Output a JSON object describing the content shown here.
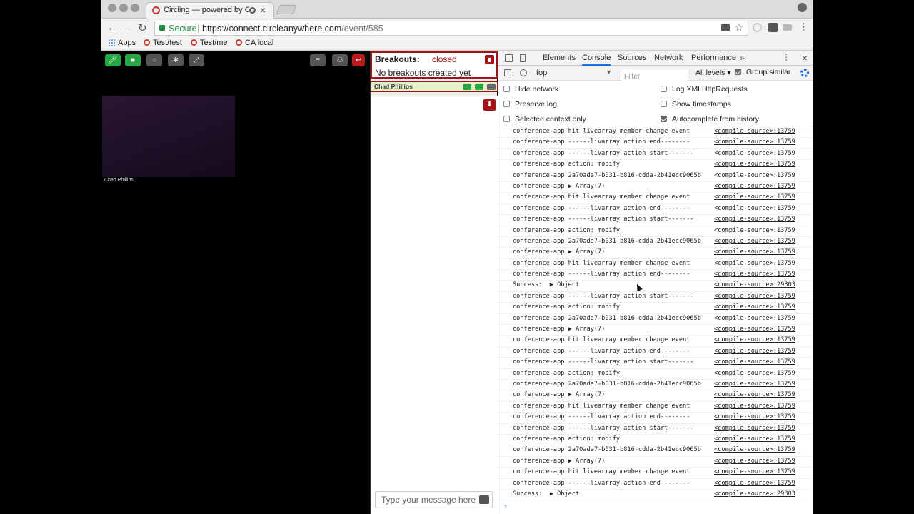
{
  "browser": {
    "tab_title": "Circling — powered by Circling",
    "url_secure_label": "Secure",
    "url_host": "https://connect.circleanywhere.com",
    "url_path": "/event/585",
    "bookmarks": [
      {
        "label": "Apps"
      },
      {
        "label": "Test/test"
      },
      {
        "label": "Test/me"
      },
      {
        "label": "CA local"
      }
    ]
  },
  "video": {
    "participant_name": "Chad Phillips"
  },
  "breakouts": {
    "title": "Breakouts:",
    "status": "closed",
    "empty_message": "No breakouts created yet",
    "room_participant": "Chad Phillips",
    "chat_placeholder": "Type your message here"
  },
  "devtools": {
    "tabs": [
      "Elements",
      "Console",
      "Sources",
      "Network",
      "Performance"
    ],
    "more": "»",
    "context": "top",
    "filter_placeholder": "Filter",
    "levels": "All levels ▾",
    "group_similar": "Group similar",
    "options": {
      "hide_network": "Hide network",
      "preserve_log": "Preserve log",
      "selected_context": "Selected context only",
      "log_xhr": "Log XMLHttpRequests",
      "show_timestamps": "Show timestamps",
      "autocomplete": "Autocomplete from history"
    },
    "logs": [
      {
        "msg": "conference-app hit livearray member change event",
        "src": "<compile-source>:13759"
      },
      {
        "msg": "conference-app ------livarray action end--------",
        "src": "<compile-source>:13759"
      },
      {
        "msg": "conference-app ------livarray action start-------",
        "src": "<compile-source>:13759"
      },
      {
        "msg": "conference-app action: modify",
        "src": "<compile-source>:13759"
      },
      {
        "msg": "conference-app 2a70ade7-b031-b816-cdda-2b41ecc9065b",
        "src": "<compile-source>:13759"
      },
      {
        "msg": "conference-app ▶ Array(7)",
        "src": "<compile-source>:13759"
      },
      {
        "msg": "conference-app hit livearray member change event",
        "src": "<compile-source>:13759"
      },
      {
        "msg": "conference-app ------livarray action end--------",
        "src": "<compile-source>:13759"
      },
      {
        "msg": "conference-app ------livarray action start-------",
        "src": "<compile-source>:13759"
      },
      {
        "msg": "conference-app action: modify",
        "src": "<compile-source>:13759"
      },
      {
        "msg": "conference-app 2a70ade7-b031-b816-cdda-2b41ecc9065b",
        "src": "<compile-source>:13759"
      },
      {
        "msg": "conference-app ▶ Array(7)",
        "src": "<compile-source>:13759"
      },
      {
        "msg": "conference-app hit livearray member change event",
        "src": "<compile-source>:13759"
      },
      {
        "msg": "conference-app ------livarray action end--------",
        "src": "<compile-source>:13759"
      },
      {
        "msg": "Success:  ▶ Object",
        "src": "<compile-source>:29803"
      },
      {
        "msg": "conference-app ------livarray action start-------",
        "src": "<compile-source>:13759"
      },
      {
        "msg": "conference-app action: modify",
        "src": "<compile-source>:13759"
      },
      {
        "msg": "conference-app 2a70ade7-b031-b816-cdda-2b41ecc9065b",
        "src": "<compile-source>:13759"
      },
      {
        "msg": "conference-app ▶ Array(7)",
        "src": "<compile-source>:13759"
      },
      {
        "msg": "conference-app hit livearray member change event",
        "src": "<compile-source>:13759"
      },
      {
        "msg": "conference-app ------livarray action end--------",
        "src": "<compile-source>:13759"
      },
      {
        "msg": "conference-app ------livarray action start-------",
        "src": "<compile-source>:13759"
      },
      {
        "msg": "conference-app action: modify",
        "src": "<compile-source>:13759"
      },
      {
        "msg": "conference-app 2a70ade7-b031-b816-cdda-2b41ecc9065b",
        "src": "<compile-source>:13759"
      },
      {
        "msg": "conference-app ▶ Array(7)",
        "src": "<compile-source>:13759"
      },
      {
        "msg": "conference-app hit livearray member change event",
        "src": "<compile-source>:13759"
      },
      {
        "msg": "conference-app ------livarray action end--------",
        "src": "<compile-source>:13759"
      },
      {
        "msg": "conference-app ------livarray action start-------",
        "src": "<compile-source>:13759"
      },
      {
        "msg": "conference-app action: modify",
        "src": "<compile-source>:13759"
      },
      {
        "msg": "conference-app 2a70ade7-b031-b816-cdda-2b41ecc9065b",
        "src": "<compile-source>:13759"
      },
      {
        "msg": "conference-app ▶ Array(7)",
        "src": "<compile-source>:13759"
      },
      {
        "msg": "conference-app hit livearray member change event",
        "src": "<compile-source>:13759"
      },
      {
        "msg": "conference-app ------livarray action end--------",
        "src": "<compile-source>:13759"
      },
      {
        "msg": "Success:  ▶ Object",
        "src": "<compile-source>:29803"
      }
    ],
    "prompt_caret": "›"
  },
  "colors": {
    "brand_red": "#a31515",
    "video_green": "#27a844",
    "secure_green": "#1e8e3e",
    "devtools_blue": "#1a73e8"
  }
}
